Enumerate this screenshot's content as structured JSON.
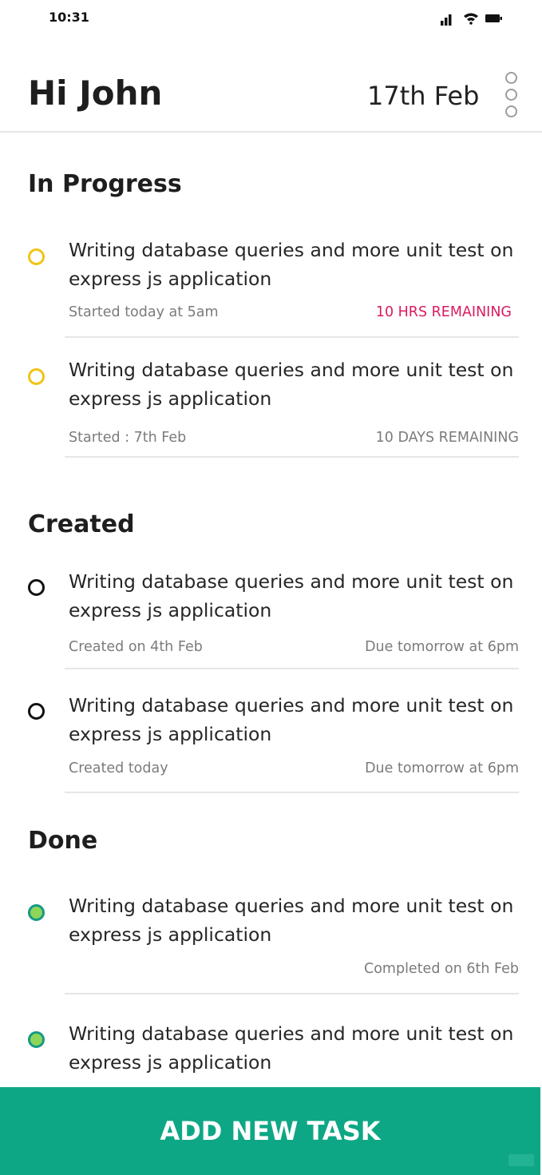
{
  "status_bar": {
    "time": "10:31",
    "icons": [
      "signal-icon",
      "wifi-icon",
      "battery-icon"
    ]
  },
  "header": {
    "greeting": "Hi John",
    "date": "17th Feb",
    "menu_icon": "more-vertical-icon"
  },
  "colors": {
    "accent": "#0ea785",
    "in_progress": "#f2c316",
    "created": "#111111",
    "done_fill": "#8dd65a",
    "done_ring": "#169a84",
    "urgent": "#d81b60"
  },
  "sections": {
    "in_progress": {
      "title": "In Progress",
      "tasks": [
        {
          "title": "Writing database queries and more unit test on express js application",
          "meta_left": "Started today at 5am",
          "meta_right": "10 HRS REMAINING"
        },
        {
          "title": "Writing database queries and more unit test on express js application",
          "meta_left": "Started : 7th Feb",
          "meta_right": "10 DAYS REMAINING"
        }
      ]
    },
    "created": {
      "title": "Created",
      "tasks": [
        {
          "title": "Writing database queries and more unit test on express js application",
          "meta_left": "Created on 4th Feb",
          "meta_right": "Due tomorrow at 6pm"
        },
        {
          "title": "Writing database queries and more unit test on express js application",
          "meta_left": "Created today",
          "meta_right": "Due tomorrow at 6pm"
        }
      ]
    },
    "done": {
      "title": "Done",
      "tasks": [
        {
          "title": "Writing database queries and more unit test on express js application",
          "meta_right": "Completed on 6th Feb"
        },
        {
          "title": "Writing database queries and more unit test on express js application"
        }
      ]
    }
  },
  "add_button": {
    "label": "ADD NEW TASK"
  }
}
